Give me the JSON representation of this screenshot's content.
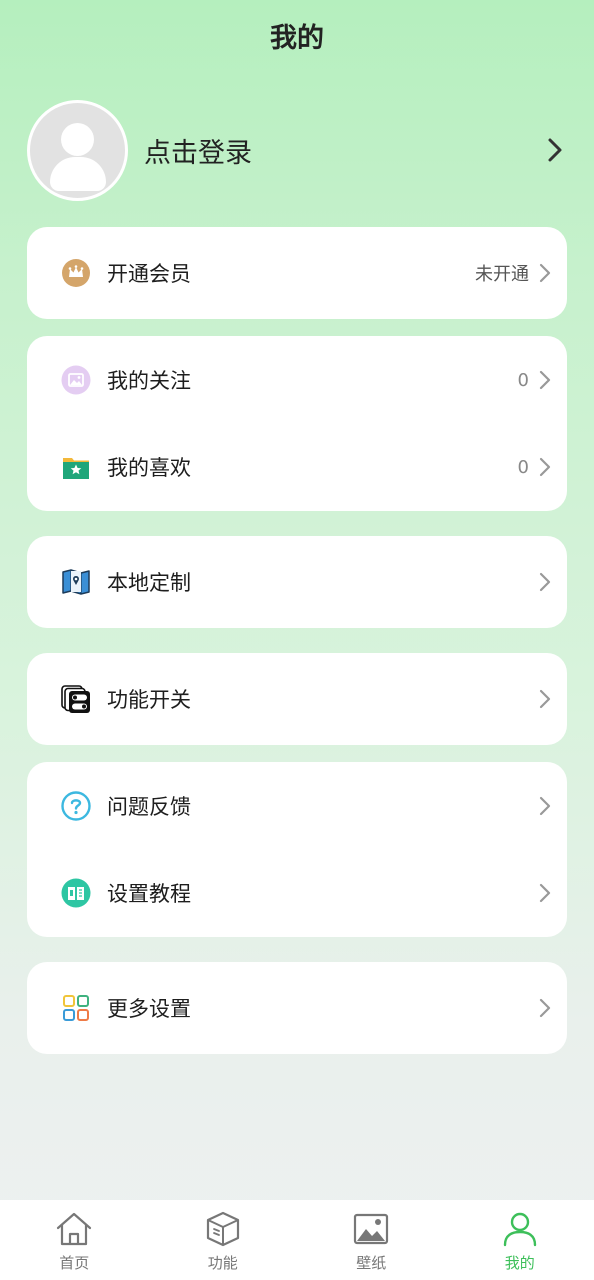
{
  "header": {
    "title": "我的"
  },
  "profile": {
    "login_text": "点击登录",
    "avatar_icon": "default-avatar-icon"
  },
  "cards": {
    "vip": {
      "label": "开通会员",
      "value": "未开通",
      "icon": "crown-icon"
    },
    "follow": {
      "label": "我的关注",
      "value": "0",
      "icon": "image-icon"
    },
    "like": {
      "label": "我的喜欢",
      "value": "0",
      "icon": "star-folder-icon"
    },
    "local": {
      "label": "本地定制",
      "icon": "map-pin-icon"
    },
    "switches": {
      "label": "功能开关",
      "icon": "toggle-icon"
    },
    "feedback": {
      "label": "问题反馈",
      "icon": "question-icon"
    },
    "tutorial": {
      "label": "设置教程",
      "icon": "book-icon"
    },
    "more": {
      "label": "更多设置",
      "icon": "grid-icon"
    }
  },
  "tabbar": {
    "items": [
      {
        "label": "首页",
        "icon": "home-icon"
      },
      {
        "label": "功能",
        "icon": "box-icon"
      },
      {
        "label": "壁纸",
        "icon": "picture-icon"
      },
      {
        "label": "我的",
        "icon": "person-icon",
        "active": true
      }
    ],
    "active_color": "#3dbf5a"
  },
  "colors": {
    "accent": "#3dbf5a",
    "vip_icon": "#d4a56a",
    "feedback_icon": "#3cb8e0",
    "tutorial_icon": "#2ec6a3"
  }
}
